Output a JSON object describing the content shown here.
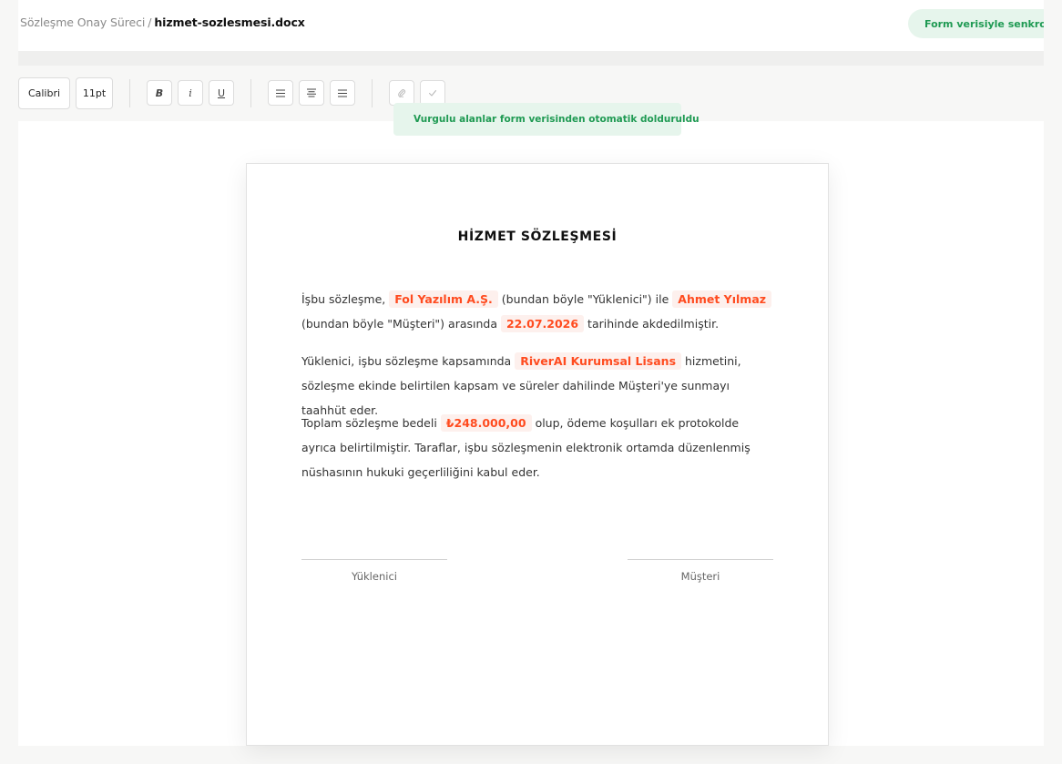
{
  "breadcrumb": {
    "parent": "Sözleşme Onay Süreci",
    "separator": "/",
    "current": "hizmet-sozlesmesi.docx"
  },
  "sync_status": {
    "icon": "check-icon",
    "label": "Form verisiyle senkron"
  },
  "toolbar": {
    "font_family": "Calibri",
    "font_size": "11pt",
    "bold_label": "B",
    "italic_label": "i",
    "underline_label": "U",
    "align_left_icon": "align-left-icon",
    "align_center_icon": "align-center-icon",
    "align_justify_icon": "align-justify-icon",
    "attach_icon": "paperclip-icon",
    "check_icon": "check-icon"
  },
  "autofill_notice": {
    "icon": "lightning-icon",
    "text": "Vurgulu alanlar form verisinden otomatik dolduruldu"
  },
  "document": {
    "title": "HİZMET SÖZLEŞMESİ",
    "p1": {
      "t1": "İşbu sözleşme,",
      "contractor": "Fol Yazılım A.Ş.",
      "t2": "(bundan böyle \"Yüklenici\") ile",
      "customer": "Ahmet Yılmaz",
      "t3": "(bundan böyle \"Müşteri\") arasında",
      "date": "22.07.2026",
      "t4": "tarihinde akdedilmiştir."
    },
    "p2": {
      "t1": "Yüklenici, işbu sözleşme kapsamında",
      "service": "RiverAI Kurumsal Lisans",
      "t2": "hizmetini, sözleşme ekinde belirtilen kapsam ve süreler dahilinde Müşteri'ye sunmayı taahhüt eder."
    },
    "p3": {
      "t1": "Toplam sözleşme bedeli",
      "amount": "₺248.000,00",
      "t2": "olup, ödeme koşulları ek protokolde ayrıca belirtilmiştir. Taraflar, işbu sözleşmenin elektronik ortamda düzenlenmiş nüshasının hukuki geçerliliğini kabul eder."
    },
    "signatures": {
      "left": "Yüklenici",
      "right": "Müşteri"
    }
  },
  "colors": {
    "highlight_text": "#ff4b1f",
    "highlight_bg": "#fdf0ed",
    "success_text": "#1f9a53",
    "success_bg": "#e6f5ec"
  }
}
